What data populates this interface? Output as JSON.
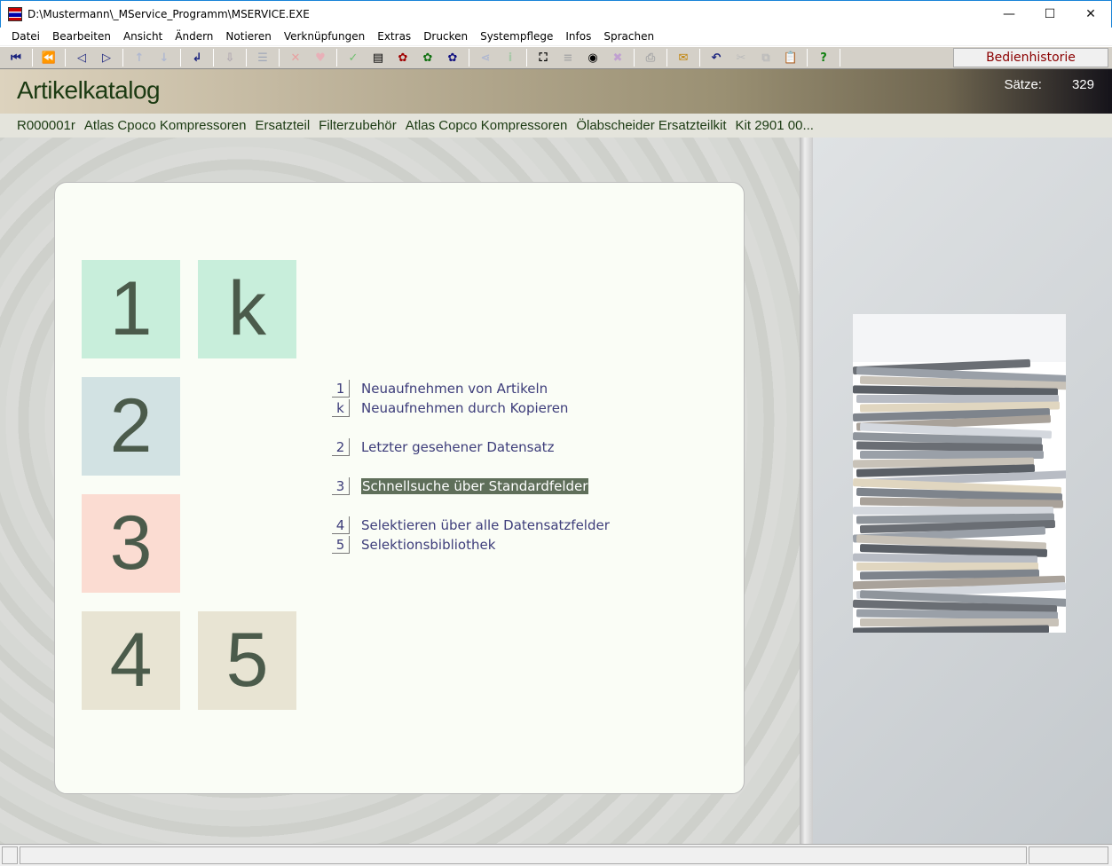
{
  "window": {
    "title": "D:\\Mustermann\\_MService_Programm\\MSERVICE.EXE",
    "minimize": "—",
    "maximize": "☐",
    "close": "✕"
  },
  "menu": [
    "Datei",
    "Bearbeiten",
    "Ansicht",
    "Ändern",
    "Notieren",
    "Verknüpfungen",
    "Extras",
    "Drucken",
    "Systempflege",
    "Infos",
    "Sprachen"
  ],
  "toolbar": {
    "history_label": "Bedienhistorie",
    "icons": [
      {
        "name": "first-record-icon",
        "g": "⏮",
        "c": "#1a237e"
      },
      {
        "sep": true
      },
      {
        "name": "fast-back-icon",
        "g": "⏪",
        "c": "#1a237e"
      },
      {
        "sep": true
      },
      {
        "name": "prev-icon",
        "g": "◁",
        "c": "#1a237e"
      },
      {
        "name": "next-icon",
        "g": "▷",
        "c": "#1a237e"
      },
      {
        "sep": true
      },
      {
        "name": "up-icon",
        "g": "↑",
        "c": "#b0b8d0"
      },
      {
        "name": "down-icon",
        "g": "↓",
        "c": "#b0b8d0"
      },
      {
        "sep": true
      },
      {
        "name": "enter-icon",
        "g": "↲",
        "c": "#1a237e"
      },
      {
        "sep": true
      },
      {
        "name": "import-icon",
        "g": "⇩",
        "c": "#b0a8b0"
      },
      {
        "sep": true
      },
      {
        "name": "tree-icon",
        "g": "☰",
        "c": "#a0a8b8"
      },
      {
        "sep": true
      },
      {
        "name": "delete-icon",
        "g": "✕",
        "c": "#e8a0a0"
      },
      {
        "name": "heart-icon",
        "g": "♥",
        "c": "#e8b0b8"
      },
      {
        "sep": true
      },
      {
        "name": "check-icon",
        "g": "✓",
        "c": "#70c070"
      },
      {
        "name": "document-icon",
        "g": "▤",
        "c": "#000"
      },
      {
        "name": "squirrel-red-icon",
        "g": "✿",
        "c": "#a00000"
      },
      {
        "name": "squirrel-green-icon",
        "g": "✿",
        "c": "#107010"
      },
      {
        "name": "squirrel-blue-icon",
        "g": "✿",
        "c": "#101080"
      },
      {
        "sep": true
      },
      {
        "name": "link-icon",
        "g": "⋖",
        "c": "#b0b8d0"
      },
      {
        "name": "info-icon",
        "g": "i",
        "c": "#a8c8a8"
      },
      {
        "sep": true
      },
      {
        "name": "binoculars-icon",
        "g": "⛶",
        "c": "#000"
      },
      {
        "name": "list-icon",
        "g": "≡",
        "c": "#aaa"
      },
      {
        "name": "eye-icon",
        "g": "◉",
        "c": "#000"
      },
      {
        "name": "filter-icon",
        "g": "✖",
        "c": "#c0a0d0"
      },
      {
        "sep": true
      },
      {
        "name": "print-icon",
        "g": "⎙",
        "c": "#aaa"
      },
      {
        "sep": true
      },
      {
        "name": "mail-icon",
        "g": "✉",
        "c": "#c08000"
      },
      {
        "sep": true
      },
      {
        "name": "undo-icon",
        "g": "↶",
        "c": "#1a237e"
      },
      {
        "name": "cut-icon",
        "g": "✂",
        "c": "#bbb"
      },
      {
        "name": "copy-icon",
        "g": "⧉",
        "c": "#bbb"
      },
      {
        "name": "paste-icon",
        "g": "📋",
        "c": "#bbb"
      },
      {
        "sep": true
      },
      {
        "name": "help-icon",
        "g": "?",
        "c": "#108010"
      },
      {
        "sep": true
      }
    ]
  },
  "header": {
    "title": "Artikelkatalog",
    "count_label": "Sätze:",
    "count": "329"
  },
  "record": [
    "R000001r",
    "Atlas Cpoco Kompressoren",
    "Ersatzteil",
    "Filterzubehör",
    "Atlas Copco Kompressoren",
    "Ölabscheider Ersatzteilkit",
    "Kit 2901 00..."
  ],
  "tiles": [
    {
      "key": "1",
      "color": "#c8eedb"
    },
    {
      "key": "k",
      "color": "#c8eedb"
    },
    {
      "key": "2",
      "color": "#d2e2e3"
    },
    {
      "key": "3",
      "color": "#fbdcd2"
    },
    {
      "key": "4",
      "color": "#e8e4d3"
    },
    {
      "key": "5",
      "color": "#e8e4d3"
    }
  ],
  "options": [
    {
      "key": "1",
      "label": "Neuaufnehmen von Artikeln"
    },
    {
      "key": "k",
      "label": "Neuaufnehmen durch Kopieren"
    },
    {
      "key": "2",
      "label": "Letzter gesehener Datensatz"
    },
    {
      "key": "3",
      "label": "Schnellsuche über Standardfelder",
      "selected": true
    },
    {
      "key": "4",
      "label": "Selektieren über alle Datensatzfelder"
    },
    {
      "key": "5",
      "label": "Selektionsbibliothek"
    }
  ]
}
